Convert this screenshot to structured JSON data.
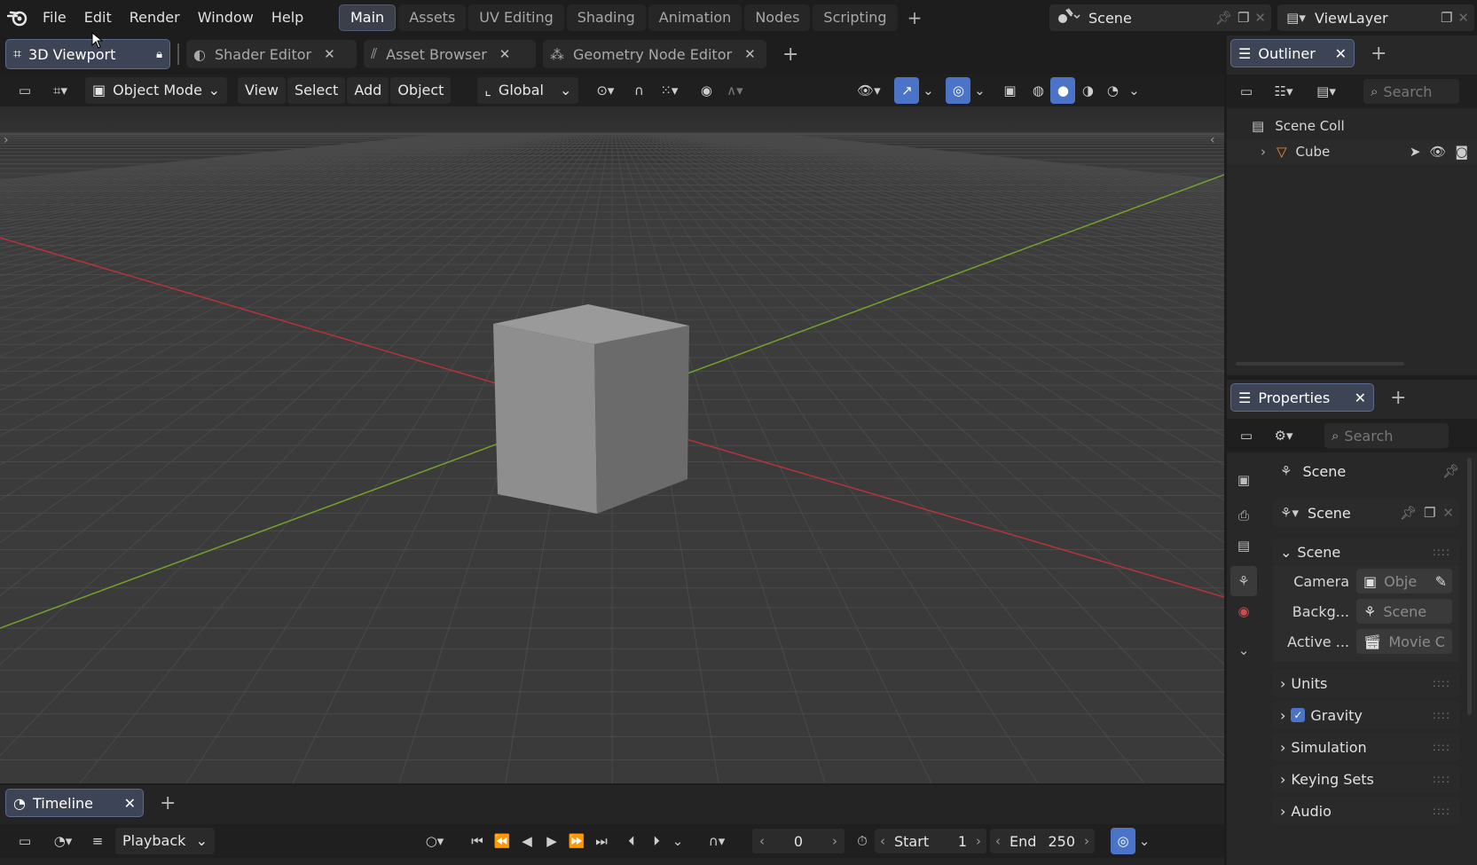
{
  "topbar": {
    "menus": [
      "File",
      "Edit",
      "Render",
      "Window",
      "Help"
    ],
    "workspaces": [
      {
        "label": "Main",
        "active": true
      },
      {
        "label": "Assets",
        "active": false
      },
      {
        "label": "UV Editing",
        "active": false
      },
      {
        "label": "Shading",
        "active": false
      },
      {
        "label": "Animation",
        "active": false
      },
      {
        "label": "Nodes",
        "active": false
      },
      {
        "label": "Scripting",
        "active": false
      }
    ],
    "scene_name": "Scene",
    "viewlayer_name": "ViewLayer"
  },
  "editor_tabs": [
    {
      "label": "3D Viewport",
      "active": true,
      "icon": "viewport-icon"
    },
    {
      "label": "Shader Editor",
      "active": false,
      "icon": "shader-icon"
    },
    {
      "label": "Asset Browser",
      "active": false,
      "icon": "asset-icon"
    },
    {
      "label": "Geometry Node Editor",
      "active": false,
      "icon": "nodes-icon"
    }
  ],
  "viewport_header": {
    "mode": "Object Mode",
    "menus": [
      "View",
      "Select",
      "Add",
      "Object"
    ],
    "transform": "Global"
  },
  "outliner": {
    "tab": "Outliner",
    "search_placeholder": "Search",
    "items": [
      {
        "label": "Scene Coll"
      },
      {
        "label": "Cube"
      }
    ]
  },
  "properties": {
    "tab": "Properties",
    "search_placeholder": "Search",
    "context_title": "Scene",
    "scene_field": "Scene",
    "panel_scene": "Scene",
    "rows": [
      {
        "label": "Camera",
        "value": "Obje"
      },
      {
        "label": "Backg...",
        "value": "Scene"
      },
      {
        "label": "Active ...",
        "value": "Movie C"
      }
    ],
    "panels": [
      {
        "label": "Units"
      },
      {
        "label": "Gravity",
        "checkbox": true
      },
      {
        "label": "Simulation"
      },
      {
        "label": "Keying Sets"
      },
      {
        "label": "Audio"
      }
    ]
  },
  "timeline": {
    "tab": "Timeline",
    "playback": "Playback",
    "current_frame": "0",
    "start_label": "Start",
    "start_value": "1",
    "end_label": "End",
    "end_value": "250"
  },
  "colors": {
    "accent": "#4b74c8",
    "x_axis": "#b5333c",
    "y_axis": "#74a12b",
    "gravity_check": "#4b74c8"
  }
}
